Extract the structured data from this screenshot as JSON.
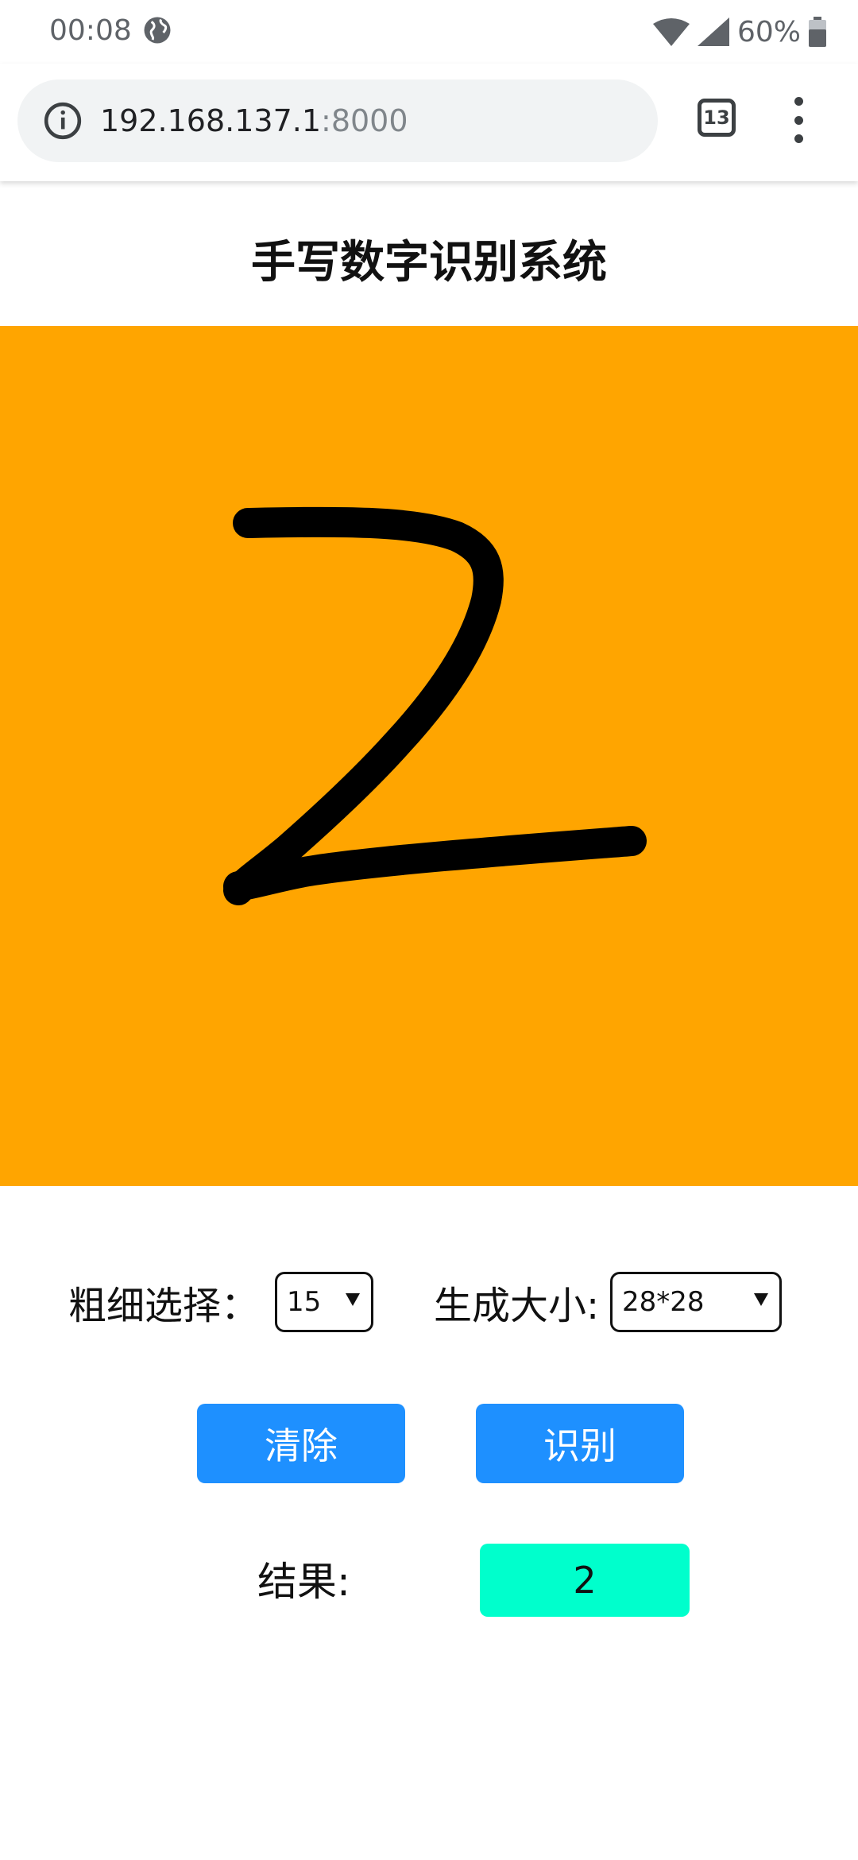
{
  "status_bar": {
    "time": "00:08",
    "battery": "60%"
  },
  "browser": {
    "url_host": "192.168.137.1",
    "url_port": ":8000",
    "tab_count": "13"
  },
  "page": {
    "title": "手写数字识别系统",
    "thickness_label": "粗细选择：",
    "thickness_value": "15",
    "size_label": "生成大小:",
    "size_value": "28*28",
    "clear_label": "清除",
    "recognize_label": "识别",
    "result_label": "结果:",
    "result_value": "2"
  },
  "colors": {
    "canvas_background": "#ffa500",
    "button": "#1e90ff",
    "result_box": "#00ffcc",
    "stroke": "#000000"
  }
}
